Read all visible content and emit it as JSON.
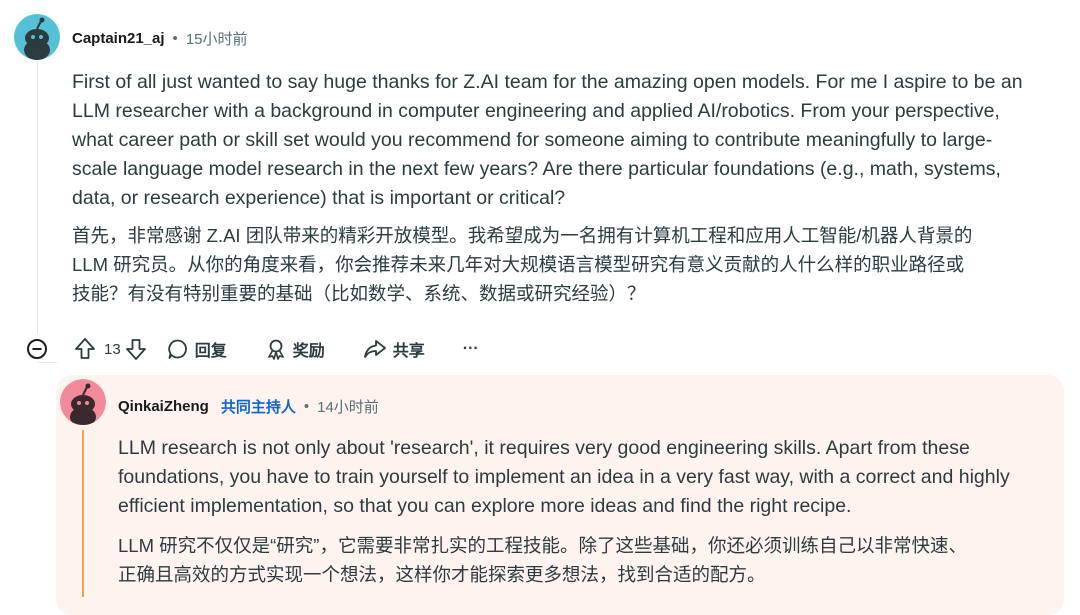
{
  "comment": {
    "username": "Captain21_aj",
    "time": "15小时前",
    "paragraphs_en": [
      "First of all just wanted to say huge thanks for Z.AI team for the amazing open models. For me I aspire to be an",
      "LLM researcher with a background in computer engineering and applied AI/robotics. From your perspective,",
      "what career path or skill set would you recommend for someone aiming to contribute meaningfully to large-",
      "scale language model research in the next few years? Are there particular foundations (e.g., math, systems,",
      "data, or research experience) that is important or critical?"
    ],
    "paragraphs_cn": [
      "首先，非常感谢 Z.AI 团队带来的精彩开放模型。我希望成为一名拥有计算机工程和应用人工智能/机器人背景的",
      "LLM 研究员。从你的角度来看，你会推荐未来几年对大规模语言模型研究有意义贡献的人什么样的职业路径或",
      "技能？有没有特别重要的基础（比如数学、系统、数据或研究经验）？"
    ],
    "actions": {
      "vote_count": "13",
      "reply": "回复",
      "award": "奖励",
      "share": "共享",
      "more": "···"
    }
  },
  "reply": {
    "username": "QinkaiZheng",
    "badge": "共同主持人",
    "time": "14小时前",
    "paragraphs_en": [
      "LLM research is not only about 'research', it requires very good engineering skills. Apart from these",
      "foundations, you have to train yourself to implement an idea in a very fast way, with a correct and highly",
      "efficient implementation, so that you can explore more ideas and find the right recipe."
    ],
    "paragraphs_cn": [
      "LLM 研究不仅仅是“研究”，它需要非常扎实的工程技能。除了这些基础，你还必须训练自己以非常快速、",
      "正确且高效的方式实现一个想法，这样你才能探索更多想法，找到合适的配方。"
    ]
  },
  "colors": {
    "reply_highlight_bg": "#fff3ef",
    "mod_badge": "#0a66d0",
    "reply_bar": "#f4a05a",
    "avatar1_bg": "#55c1d6",
    "avatar2_bg": "#f28a99"
  }
}
